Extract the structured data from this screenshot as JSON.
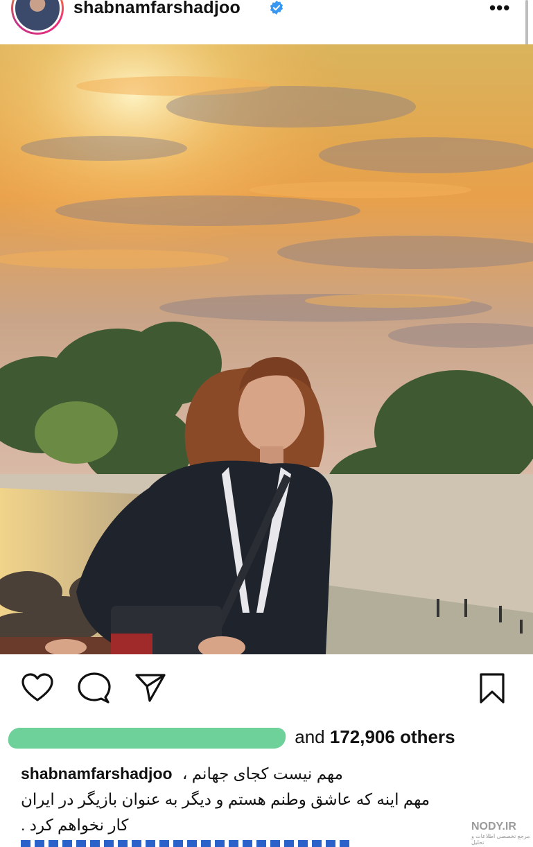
{
  "header": {
    "username": "shabnamfarshadjoo",
    "more_label": "•••"
  },
  "post": {
    "likes_prefix": "and",
    "likes_count": "172,906",
    "likes_suffix": "others",
    "caption_user": "shabnamfarshadjoo",
    "caption_lines": [
      "مهم نیست کجای جهانم ،",
      "مهم اینه که عاشق وطنم هستم  و دیگر به عنوان بازیگر در ایران",
      "کار نخواهم کرد ."
    ]
  },
  "watermark": {
    "text": "NODY.IR",
    "subtext": "مرجع تخصصی اطلاعات و تحلیل"
  },
  "colors": {
    "verified": "#3897f0",
    "redaction": "#6fd19a"
  },
  "icons": [
    "heart-icon",
    "comment-icon",
    "share-icon",
    "bookmark-icon",
    "verified-badge-icon",
    "more-options-icon"
  ]
}
